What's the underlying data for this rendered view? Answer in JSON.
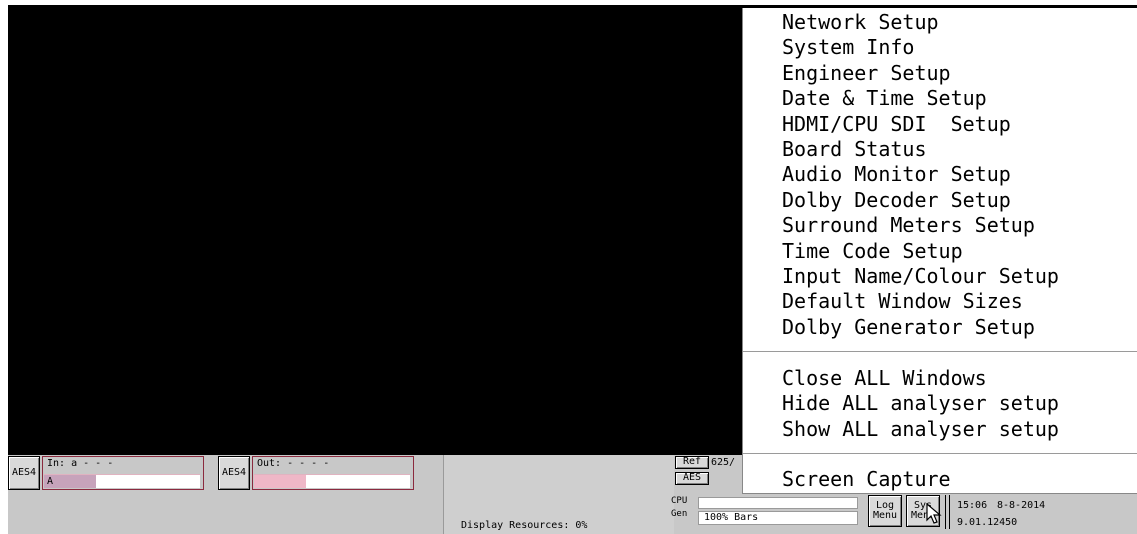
{
  "menu": {
    "group1": [
      {
        "label": "Network Setup"
      },
      {
        "label": "System Info"
      },
      {
        "label": "Engineer Setup"
      },
      {
        "label": "Date & Time Setup"
      },
      {
        "label": "HDMI/CPU SDI  Setup"
      },
      {
        "label": "Board Status"
      },
      {
        "label": "Audio Monitor Setup"
      },
      {
        "label": "Dolby Decoder Setup"
      },
      {
        "label": "Surround Meters Setup"
      },
      {
        "label": "Time Code Setup"
      },
      {
        "label": "Input Name/Colour Setup"
      },
      {
        "label": "Default Window Sizes"
      },
      {
        "label": "Dolby Generator Setup"
      }
    ],
    "group2": [
      {
        "label": "Close ALL Windows"
      },
      {
        "label": "Hide ALL analyser setup"
      },
      {
        "label": "Show ALL analyser setup"
      }
    ],
    "group3": [
      {
        "label": "Screen Capture"
      }
    ]
  },
  "status_bar": {
    "input": {
      "button": "AES4",
      "label": "In: a - - -",
      "bar_tag": "A"
    },
    "output": {
      "button": "AES4",
      "label": "Out: - - - -"
    },
    "display_resources": "Display Resources: 0%",
    "ref_button": "Ref",
    "ref_value": "625/",
    "aes_button": "AES",
    "cpu_label": "CPU",
    "gen_label": "Gen",
    "gen_value": "100% Bars",
    "log_menu": {
      "line1": "Log",
      "line2": "Menu"
    },
    "sys_menu": {
      "line1": "Sys",
      "line2": "Menu"
    },
    "time": "15:06",
    "date": "8-8-2014",
    "version": "9.01.12450"
  },
  "colors": {
    "accent_border": "#8b2a3e",
    "bar_fill": "#efb7c7"
  }
}
